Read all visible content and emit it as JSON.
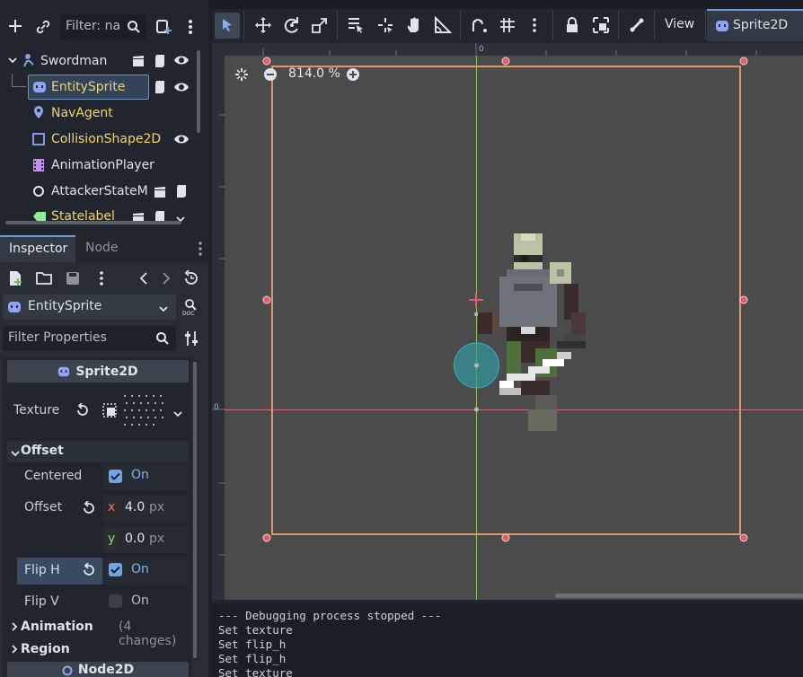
{
  "scene": {
    "filter_placeholder": "Filter: na",
    "nodes": [
      {
        "label": "Swordman",
        "icon": "character-icon",
        "color": "#e1e4e9"
      },
      {
        "label": "EntitySprite",
        "icon": "sprite-icon",
        "color": "#f1d46c"
      },
      {
        "label": "NavAgent",
        "icon": "nav-agent-icon",
        "color": "#f1d46c"
      },
      {
        "label": "CollisionShape2D",
        "icon": "collision-shape-icon",
        "color": "#f1d46c"
      },
      {
        "label": "AnimationPlayer",
        "icon": "animation-player-icon",
        "color": "#e1e4e9"
      },
      {
        "label": "AttackerStateM",
        "icon": "node-icon",
        "color": "#e1e4e9"
      },
      {
        "label": "Statelabel",
        "icon": "label-icon",
        "color": "#f1d46c"
      }
    ]
  },
  "inspector": {
    "tabs": [
      "Inspector",
      "Node"
    ],
    "object_name": "EntitySprite",
    "filter_placeholder": "Filter Properties",
    "class_header": "Sprite2D",
    "texture_label": "Texture",
    "offset_section": "Offset",
    "centered_label": "Centered",
    "centered_value": "On",
    "offset_label": "Offset",
    "offset_x_axis": "x",
    "offset_x": "4.0",
    "offset_y_axis": "y",
    "offset_y": "0.0",
    "unit": "px",
    "flip_h_label": "Flip H",
    "flip_h_value": "On",
    "flip_v_label": "Flip V",
    "flip_v_value": "On",
    "animation_section": "Animation",
    "animation_changes": "(4 changes)",
    "region_section": "Region",
    "node2d_header": "Node2D"
  },
  "toolbar": {
    "view_label": "View",
    "sprite2d_label": "Sprite2D"
  },
  "viewport": {
    "zoom": "814.0 %",
    "ruler_zero_top": "0",
    "ruler_zero_left": "0"
  },
  "output": {
    "lines": [
      "--- Debugging process stopped ---",
      "Set texture",
      "Set flip_h",
      "Set flip_h",
      "Set texture"
    ]
  },
  "colors": {
    "accent": "#6fa5e5",
    "selection_rect": "#e0956a",
    "warning_yellow": "#f1d46c"
  }
}
